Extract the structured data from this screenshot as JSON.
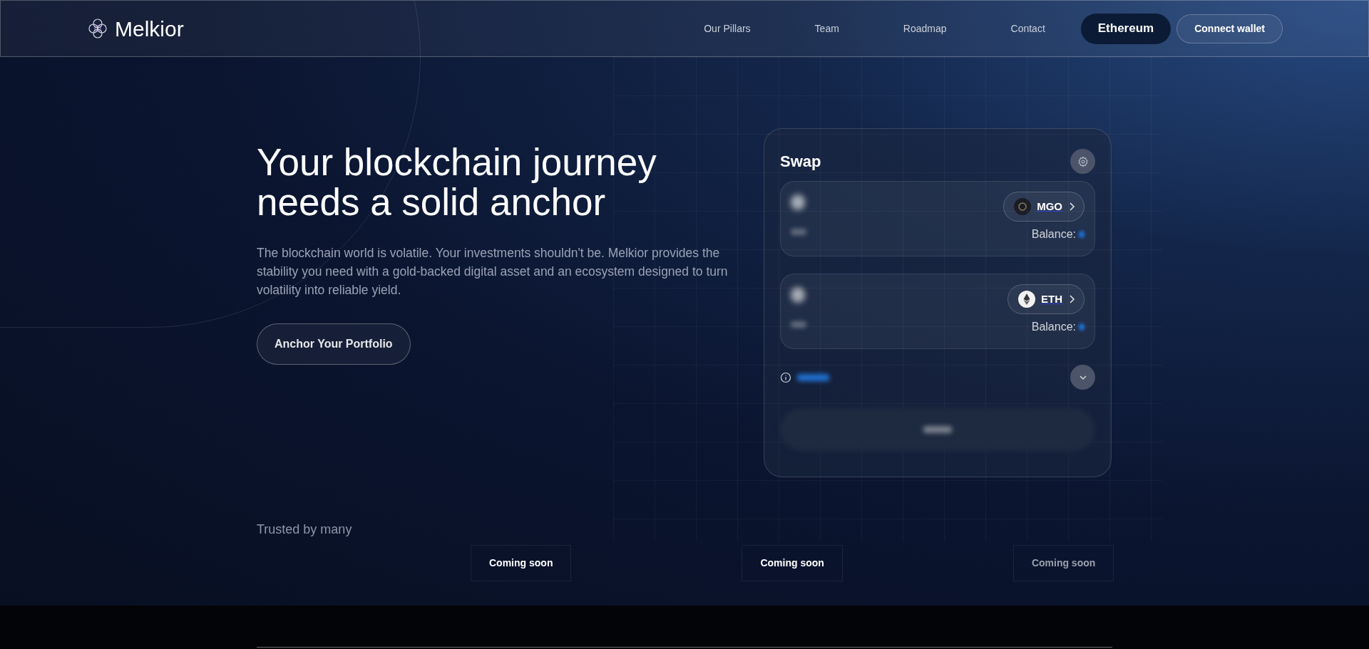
{
  "header": {
    "brand": "Melkior",
    "nav": [
      "Our Pillars",
      "Team",
      "Roadmap",
      "Contact"
    ],
    "network_button": "Ethereum",
    "connect_button": "Connect wallet"
  },
  "hero": {
    "title_lines": [
      "Your blockchain journey",
      "needs a solid anchor"
    ],
    "paragraph": "The blockchain world is volatile. Your investments shouldn't be. Melkior provides the stability you need with a gold-backed digital asset and an ecosystem designed to turn volatility into reliable yield.",
    "cta": "Anchor Your Portfolio"
  },
  "swap": {
    "title": "Swap",
    "tokens": [
      {
        "kind": "mgo",
        "symbol": "MGO",
        "balance_label": "Balance:"
      },
      {
        "kind": "eth",
        "symbol": "ETH",
        "balance_label": "Balance:"
      }
    ]
  },
  "trusted": {
    "title": "Trusted by many",
    "partners": [
      {
        "label": "Coming soon",
        "faded": false
      },
      {
        "label": "Coming soon",
        "faded": false
      },
      {
        "label": "Coming soon",
        "faded": true
      }
    ]
  }
}
